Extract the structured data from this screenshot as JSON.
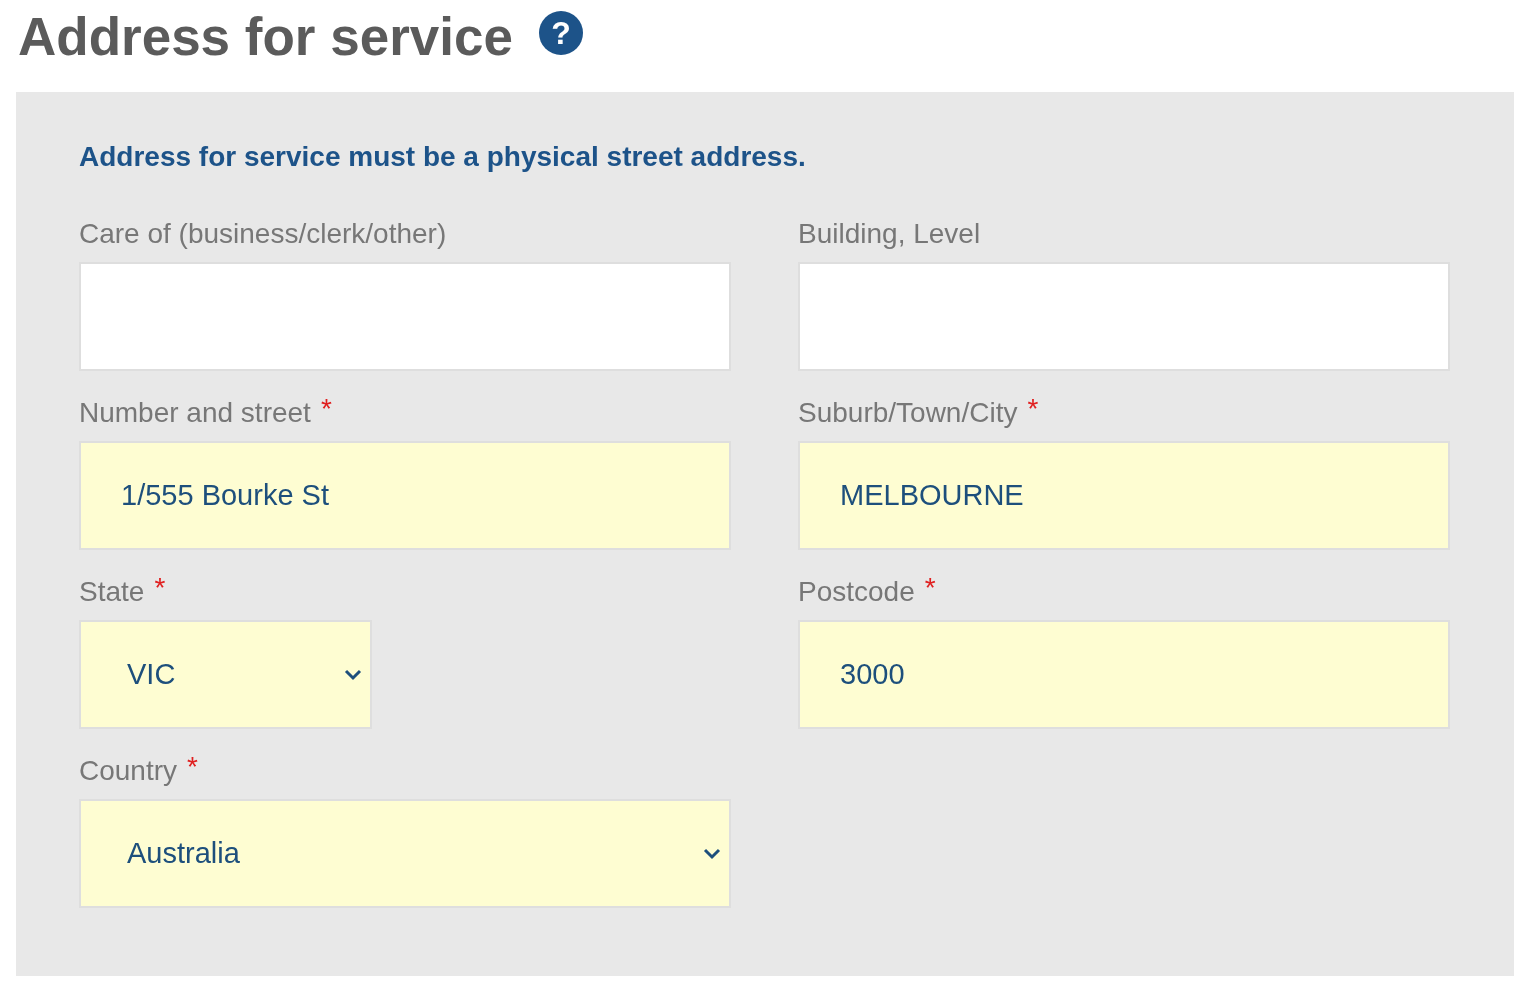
{
  "heading": {
    "title": "Address for service",
    "help_icon": "?"
  },
  "notice": "Address for service must be a physical street address.",
  "fields": [
    {
      "label": "Care of (business/clerk/other)",
      "kind": "text",
      "required": false,
      "highlighted": false
    },
    {
      "label": "Building, Level",
      "kind": "text",
      "required": false,
      "highlighted": false
    },
    {
      "label": "Number and street",
      "kind": "text",
      "required": true,
      "highlighted": true,
      "value": "1/555 Bourke St"
    },
    {
      "label": "Suburb/Town/City",
      "kind": "text",
      "required": true,
      "highlighted": true,
      "value": "MELBOURNE"
    },
    {
      "label": "State",
      "kind": "shortselect",
      "required": true,
      "highlighted": true,
      "value": "VIC"
    },
    {
      "label": "Postcode",
      "kind": "text",
      "required": true,
      "highlighted": true,
      "value": "3000"
    },
    {
      "label": "Country",
      "kind": "select",
      "required": true,
      "highlighted": true,
      "value": "Australia"
    }
  ],
  "required_marker": "*"
}
